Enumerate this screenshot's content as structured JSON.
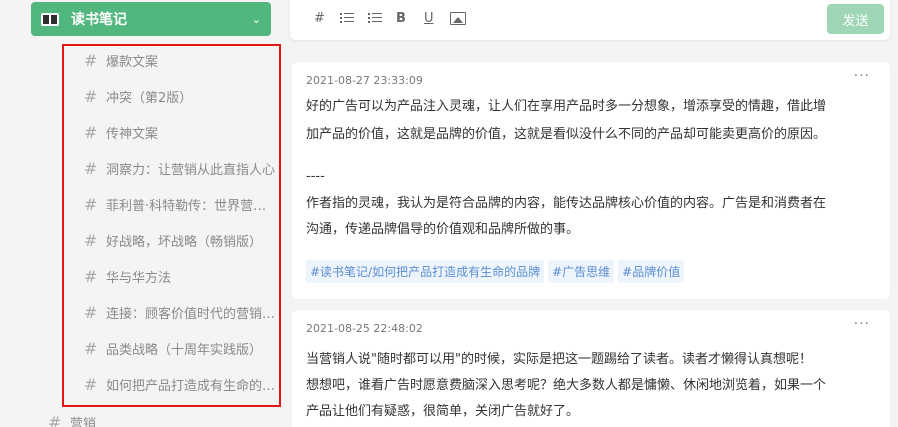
{
  "sidebar": {
    "folder": {
      "title": "读书笔记"
    },
    "tags": [
      {
        "label": "爆款文案"
      },
      {
        "label": "冲突（第2版）"
      },
      {
        "label": "传神文案"
      },
      {
        "label": "洞察力：让营销从此直指人心"
      },
      {
        "label": "菲利普·科特勒传：世界营销之父"
      },
      {
        "label": "好战略，坏战略（畅销版）"
      },
      {
        "label": "华与华方法"
      },
      {
        "label": "连接：顾客价值时代的营销战略"
      },
      {
        "label": "品类战略（十周年实践版）"
      },
      {
        "label": "如何把产品打造成有生命的品牌"
      }
    ],
    "bottom_tag": {
      "label": "营销"
    }
  },
  "toolbar": {
    "hash_label": "#",
    "bold_label": "B",
    "underline_label": "U",
    "send_label": "发送"
  },
  "memos": [
    {
      "time": "2021-08-27 23:33:09",
      "more": "···",
      "lines": [
        "好的广告可以为产品注入灵魂，让人们在享用产品时多一分想象，增添享受的情趣，借此增",
        "加产品的价值，这就是品牌的价值，这就是看似没什么不同的产品却可能卖更高价的原因。",
        "",
        "----",
        "作者指的灵魂，我认为是符合品牌的内容，能传达品牌核心价值的内容。广告是和消费者在",
        "沟通，传递品牌倡导的价值观和品牌所做的事。"
      ],
      "tags": [
        "#读书笔记/如何把产品打造成有生命的品牌",
        "#广告思维",
        "#品牌价值"
      ]
    },
    {
      "time": "2021-08-25 22:48:02",
      "more": "···",
      "lines": [
        "当营销人说\"随时都可以用\"的时候，实际是把这一题踢给了读者。读者才懒得认真想呢！",
        "想想吧，谁看广告时愿意费脑深入思考呢？绝大多数人都是慵懒、休闲地浏览着，如果一个",
        "产品让他们有疑惑，很简单，关闭广告就好了。"
      ]
    }
  ]
}
